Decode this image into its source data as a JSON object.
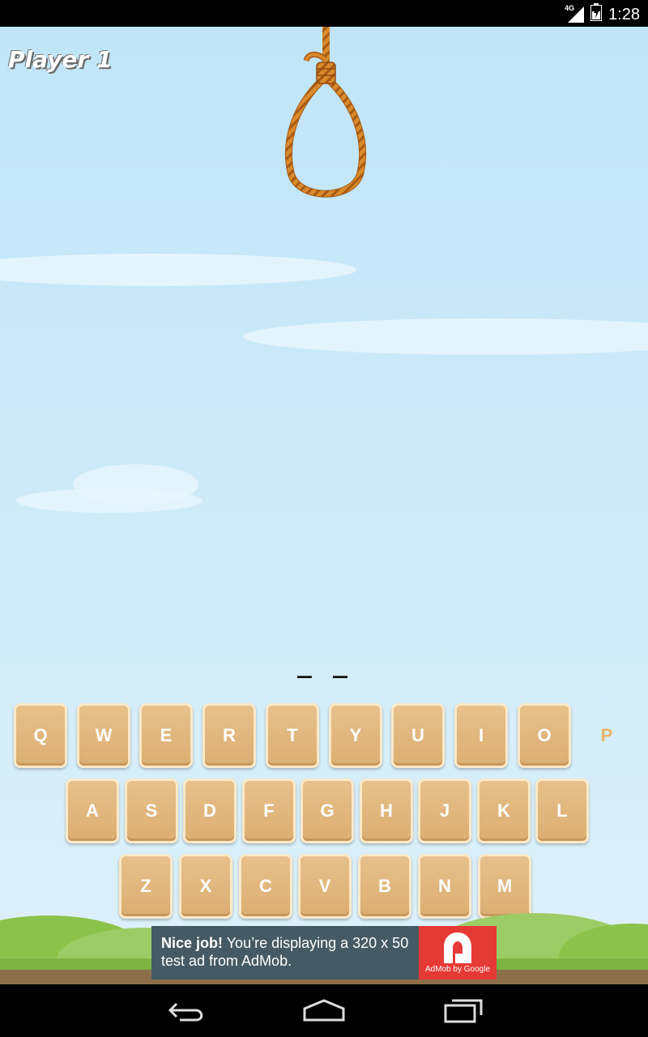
{
  "status_bar": {
    "network": "4G",
    "time": "1:28"
  },
  "game": {
    "player_label": "Player 1",
    "word_blanks": "_ _"
  },
  "keyboard": {
    "rows": [
      [
        "Q",
        "W",
        "E",
        "R",
        "T",
        "Y",
        "U",
        "I",
        "O",
        "P"
      ],
      [
        "A",
        "S",
        "D",
        "F",
        "G",
        "H",
        "J",
        "K",
        "L"
      ],
      [
        "Z",
        "X",
        "C",
        "V",
        "B",
        "N",
        "M"
      ]
    ],
    "used_letters": [
      "P"
    ]
  },
  "ad": {
    "headline": "Nice job!",
    "body": "You’re displaying a 320 x 50 test ad from AdMob.",
    "logo_caption": "AdMob by Google"
  },
  "colors": {
    "key_face": "#dcae72",
    "key_border": "#fbe9c8",
    "used_letter": "#e8b469",
    "ad_background": "#455a64",
    "ad_logo": "#e53935"
  },
  "icons": {
    "nav_back": "back-arrow-icon",
    "nav_home": "home-icon",
    "nav_recents": "recents-icon",
    "network": "signal-icon",
    "battery": "battery-icon"
  }
}
